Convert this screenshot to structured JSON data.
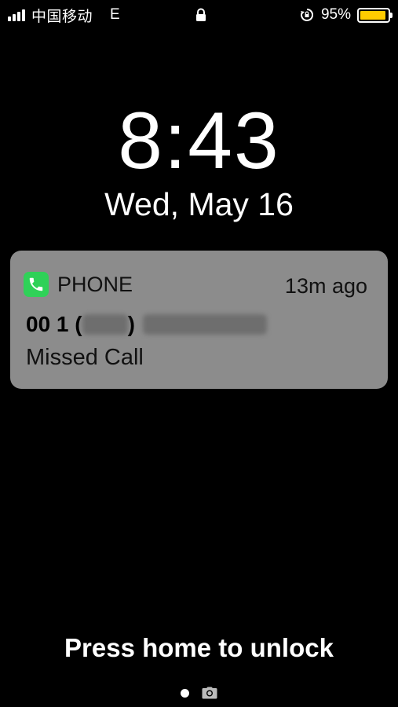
{
  "status_bar": {
    "carrier": "中国移动",
    "network": "E",
    "battery_percent": "95%",
    "battery_level": 0.95,
    "battery_color": "#ffcc00",
    "icons": [
      "signal-icon",
      "lock-icon",
      "rotation-lock-icon",
      "battery-icon"
    ]
  },
  "lock_screen": {
    "time": "8:43",
    "date": "Wed, May 16"
  },
  "notification": {
    "app_icon": "phone-icon",
    "app_icon_color": "#2fd158",
    "app_name": "PHONE",
    "time_ago": "13m ago",
    "title_prefix": "00 1 (",
    "title_mid": ")",
    "body": "Missed Call"
  },
  "bottom": {
    "unlock_hint": "Press home to unlock",
    "icons": [
      "page-dot-icon",
      "camera-icon"
    ]
  }
}
